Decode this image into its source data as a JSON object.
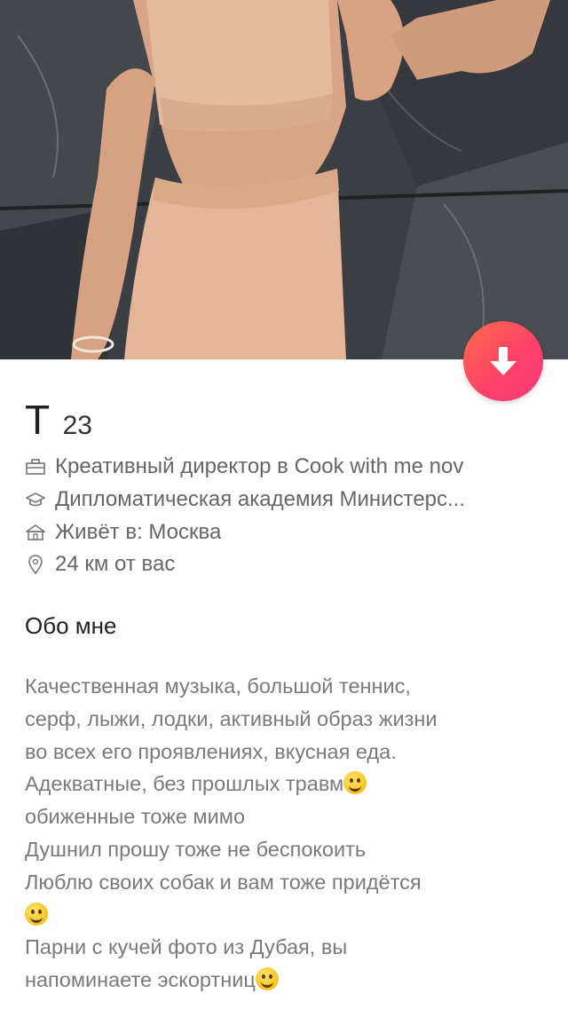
{
  "profile": {
    "name": "T",
    "age": "23",
    "job": "Креативный директор в Cook with me nov",
    "school": "Дипломатическая академия Министерс...",
    "lives": "Живёт в: Москва",
    "distance": "24 км от вас"
  },
  "about": {
    "title": "Обо мне",
    "line1": "Качественная музыка, большой теннис,",
    "line2": "серф, лыжи, лодки, активный образ жизни",
    "line3": "во всех его проявлениях, вкусная еда.",
    "line4": "Адекватные, без прошлых травм",
    "line5": "обиженные тоже мимо",
    "line6": "Душнил прошу тоже не беспокоить",
    "line7": "Люблю своих собак и вам тоже придётся",
    "line8": "Парни с кучей фото из Дубая, вы",
    "line9": "напоминаете эскортниц"
  },
  "icons": {
    "job": "briefcase-icon",
    "school": "graduation-cap-icon",
    "lives": "house-icon",
    "distance": "location-pin-icon",
    "down": "arrow-down-icon"
  },
  "colors": {
    "accent_start": "#ff6b4a",
    "accent_end": "#f23a7a",
    "text_primary": "#222222",
    "text_secondary": "#666666"
  }
}
